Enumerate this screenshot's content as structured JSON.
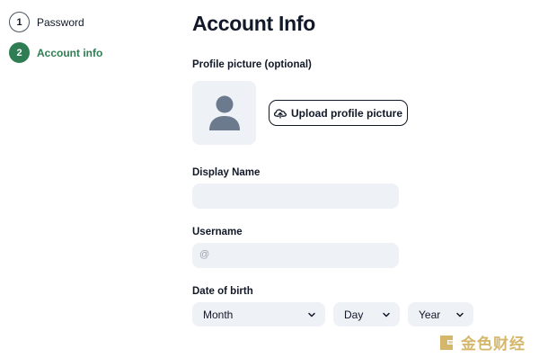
{
  "stepper": {
    "steps": [
      {
        "number": "1",
        "label": "Password",
        "state": "completed"
      },
      {
        "number": "2",
        "label": "Account info",
        "state": "active"
      }
    ],
    "active_color": "#2f7d52"
  },
  "form": {
    "title": "Account Info",
    "profile_picture": {
      "label": "Profile picture (optional)",
      "upload_button": "Upload profile picture",
      "upload_icon": "upload-cloud-icon",
      "placeholder_icon": "user-avatar-icon"
    },
    "display_name": {
      "label": "Display Name",
      "value": "",
      "placeholder": ""
    },
    "username": {
      "label": "Username",
      "prefix": "@",
      "value": "",
      "placeholder": ""
    },
    "date_of_birth": {
      "label": "Date of birth",
      "month": "Month",
      "day": "Day",
      "year": "Year"
    }
  },
  "watermark": {
    "text": "金色财经",
    "color": "#c89f3c"
  }
}
